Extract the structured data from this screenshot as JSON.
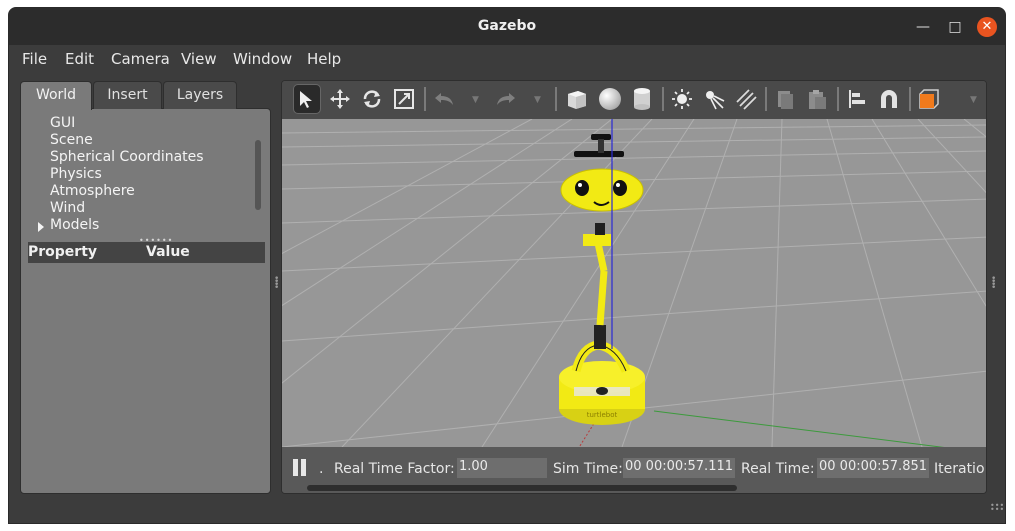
{
  "window": {
    "title": "Gazebo"
  },
  "menubar": {
    "items": [
      "File",
      "Edit",
      "Camera",
      "View",
      "Window",
      "Help"
    ]
  },
  "left_panel": {
    "tabs": [
      "World",
      "Insert",
      "Layers"
    ],
    "active_tab": "World",
    "tree_items": [
      "GUI",
      "Scene",
      "Spherical Coordinates",
      "Physics",
      "Atmosphere",
      "Wind",
      "Models"
    ],
    "property_header": {
      "property": "Property",
      "value": "Value"
    }
  },
  "toolbar": {
    "icons": [
      "select-arrow-icon",
      "translate-icon",
      "rotate-icon",
      "scale-icon",
      "undo-icon",
      "redo-icon",
      "box-icon",
      "sphere-icon",
      "cylinder-icon",
      "point-light-icon",
      "spot-light-icon",
      "directional-light-icon",
      "copy-icon",
      "paste-icon",
      "align-icon",
      "snap-icon",
      "view-angle-icon"
    ],
    "active_tool": "select-arrow-icon"
  },
  "statusbar": {
    "real_time_factor_label": "Real Time Factor:",
    "real_time_factor_value": "1.00",
    "sim_time_label": "Sim Time:",
    "sim_time_value": "00 00:00:57.111",
    "real_time_label": "Real Time:",
    "real_time_value": "00 00:00:57.851",
    "iterations_label": "Iteratio",
    "dot": "."
  },
  "colors": {
    "close_button": "#e95420",
    "robot_yellow": "#f2ea14",
    "viewport_bg": "#979797",
    "titlebar": "#2c2c2c"
  }
}
